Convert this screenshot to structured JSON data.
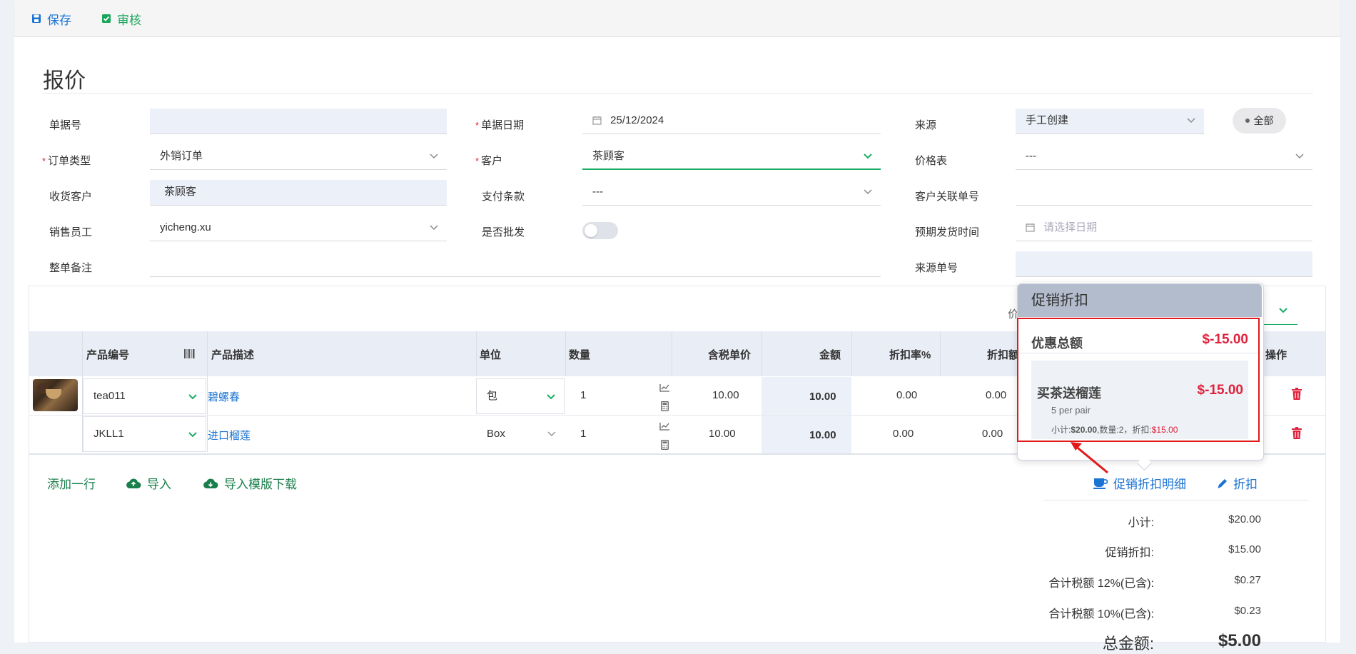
{
  "toolbar": {
    "save_label": "保存",
    "audit_label": "审核"
  },
  "page_title": "报价",
  "form": {
    "doc_no": {
      "label": "单据号",
      "value": ""
    },
    "doc_date": {
      "label": "单据日期",
      "value": "25/12/2024"
    },
    "source": {
      "label": "来源",
      "value": "手工创建"
    },
    "filter_all": "全部",
    "order_type": {
      "label": "订单类型",
      "value": "外销订单"
    },
    "customer": {
      "label": "客户",
      "value": "茶顾客"
    },
    "price_list": {
      "label": "价格表",
      "value": "---"
    },
    "ship_customer": {
      "label": "收货客户",
      "value": "茶顾客"
    },
    "payment_terms": {
      "label": "支付条款",
      "value": "---"
    },
    "cust_ref": {
      "label": "客户关联单号",
      "value": ""
    },
    "salesperson": {
      "label": "销售员工",
      "value": "yicheng.xu"
    },
    "wholesale": {
      "label": "是否批发"
    },
    "expected_ship": {
      "label": "预期发货时间",
      "placeholder": "请选择日期"
    },
    "note": {
      "label": "整单备注",
      "value": ""
    },
    "source_no": {
      "label": "来源单号",
      "value": ""
    },
    "partial_label": "价"
  },
  "table": {
    "headers": {
      "product_code": "产品编号",
      "desc": "产品描述",
      "unit": "单位",
      "qty": "数量",
      "unit_price": "含税单价",
      "amount": "金额",
      "disc_rate": "折扣率%",
      "disc_amt": "折扣额",
      "ops": "操作"
    },
    "rows": [
      {
        "code": "tea011",
        "desc": "碧螺春",
        "unit": "包",
        "qty": "1",
        "price": "10.00",
        "amount": "10.00",
        "disc_rate": "0.00",
        "disc_amt": "0.00"
      },
      {
        "code": "JKLL1",
        "desc": "进口榴莲",
        "unit": "Box",
        "qty": "1",
        "price": "10.00",
        "amount": "10.00",
        "disc_rate": "0.00",
        "disc_amt": "0.00"
      }
    ]
  },
  "footer": {
    "add_row": "添加一行",
    "import": "导入",
    "template_download": "导入模版下载",
    "promo_detail": "促销折扣明细",
    "discount": "折扣"
  },
  "summary": {
    "subtotal": {
      "label": "小计:",
      "value": "$20.00"
    },
    "promo": {
      "label": "促销折扣:",
      "value": "$15.00"
    },
    "tax12": {
      "label": "合计税额 12%(已含):",
      "value": "$0.27"
    },
    "tax10": {
      "label": "合计税额 10%(已含):",
      "value": "$0.23"
    },
    "total": {
      "label": "总金额:",
      "value": "$5.00"
    }
  },
  "popover": {
    "title": "促销折扣",
    "total_label": "优惠总额",
    "total_value": "$-15.00",
    "item_name": "买茶送榴莲",
    "item_value": "$-15.00",
    "item_sub": "5 per pair",
    "detail_prefix": "小计:",
    "detail_subtotal": "$20.00",
    "detail_qty": ",数量:2，折扣:",
    "detail_discount": "$15.00"
  },
  "colors": {
    "primary": "#1b73d3",
    "success": "#19a55a",
    "danger": "#e0223c",
    "header_bg": "#e9edf5"
  }
}
